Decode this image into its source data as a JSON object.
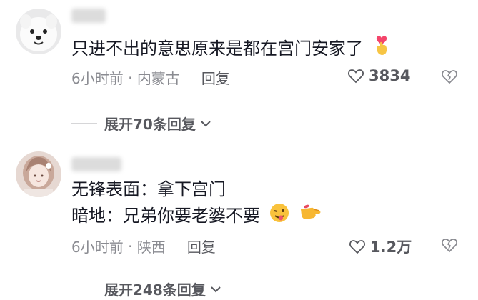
{
  "comments": [
    {
      "avatar_icon": "samoyed-dog-avatar",
      "text_lines": [
        "只进不出的意思原来是都在宫门安家了"
      ],
      "trailing_emoji": "finger-heart-emoji",
      "time": "6小时前",
      "location": "内蒙古",
      "reply_label": "回复",
      "likes": "3834",
      "expand_label": "展开70条回复"
    },
    {
      "avatar_icon": "anime-girl-avatar",
      "text_lines": [
        "无锋表面：拿下宫门",
        "暗地：兄弟你要老婆不要"
      ],
      "trailing_emoji": "winking-tongue-emoji, pointing-hand-emoji",
      "time": "6小时前",
      "location": "陕西",
      "reply_label": "回复",
      "likes": "1.2万",
      "expand_label": "展开248条回复"
    }
  ],
  "colors": {
    "text_primary": "#161823",
    "text_secondary": "#8a8b91",
    "action_gray": "#57585e"
  }
}
